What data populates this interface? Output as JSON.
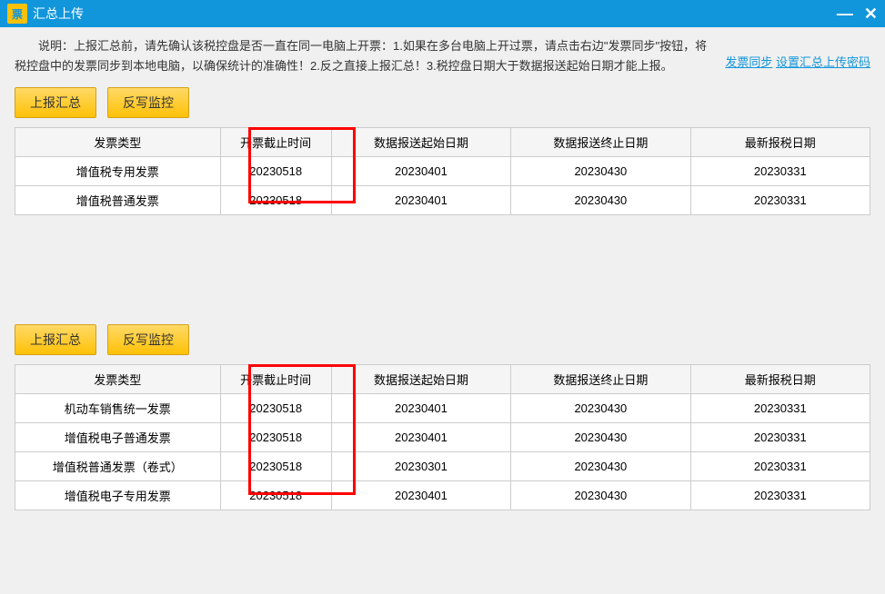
{
  "titleBar": {
    "icon": "票",
    "title": "汇总上传"
  },
  "description": {
    "text": "说明：上报汇总前，请先确认该税控盘是否一直在同一电脑上开票：1.如果在多台电脑上开过票，请点击右边\"发票同步\"按钮，将税控盘中的发票同步到本地电脑，以确保统计的准确性！2.反之直接上报汇总！3.税控盘日期大于数据报送起始日期才能上报。",
    "link1": "发票同步",
    "link2": "设置汇总上传密码"
  },
  "buttons": {
    "report": "上报汇总",
    "writeback": "反写监控"
  },
  "columns": {
    "type": "发票类型",
    "deadline": "开票截止时间",
    "startDate": "数据报送起始日期",
    "endDate": "数据报送终止日期",
    "latestDate": "最新报税日期"
  },
  "table1": {
    "rows": [
      {
        "type": "增值税专用发票",
        "deadline": "20230518",
        "start": "20230401",
        "end": "20230430",
        "latest": "20230331"
      },
      {
        "type": "增值税普通发票",
        "deadline": "20230518",
        "start": "20230401",
        "end": "20230430",
        "latest": "20230331"
      }
    ]
  },
  "table2": {
    "rows": [
      {
        "type": "机动车销售统一发票",
        "deadline": "20230518",
        "start": "20230401",
        "end": "20230430",
        "latest": "20230331"
      },
      {
        "type": "增值税电子普通发票",
        "deadline": "20230518",
        "start": "20230401",
        "end": "20230430",
        "latest": "20230331"
      },
      {
        "type": "增值税普通发票（卷式）",
        "deadline": "20230518",
        "start": "20230301",
        "end": "20230430",
        "latest": "20230331"
      },
      {
        "type": "增值税电子专用发票",
        "deadline": "20230518",
        "start": "20230401",
        "end": "20230430",
        "latest": "20230331"
      }
    ]
  }
}
